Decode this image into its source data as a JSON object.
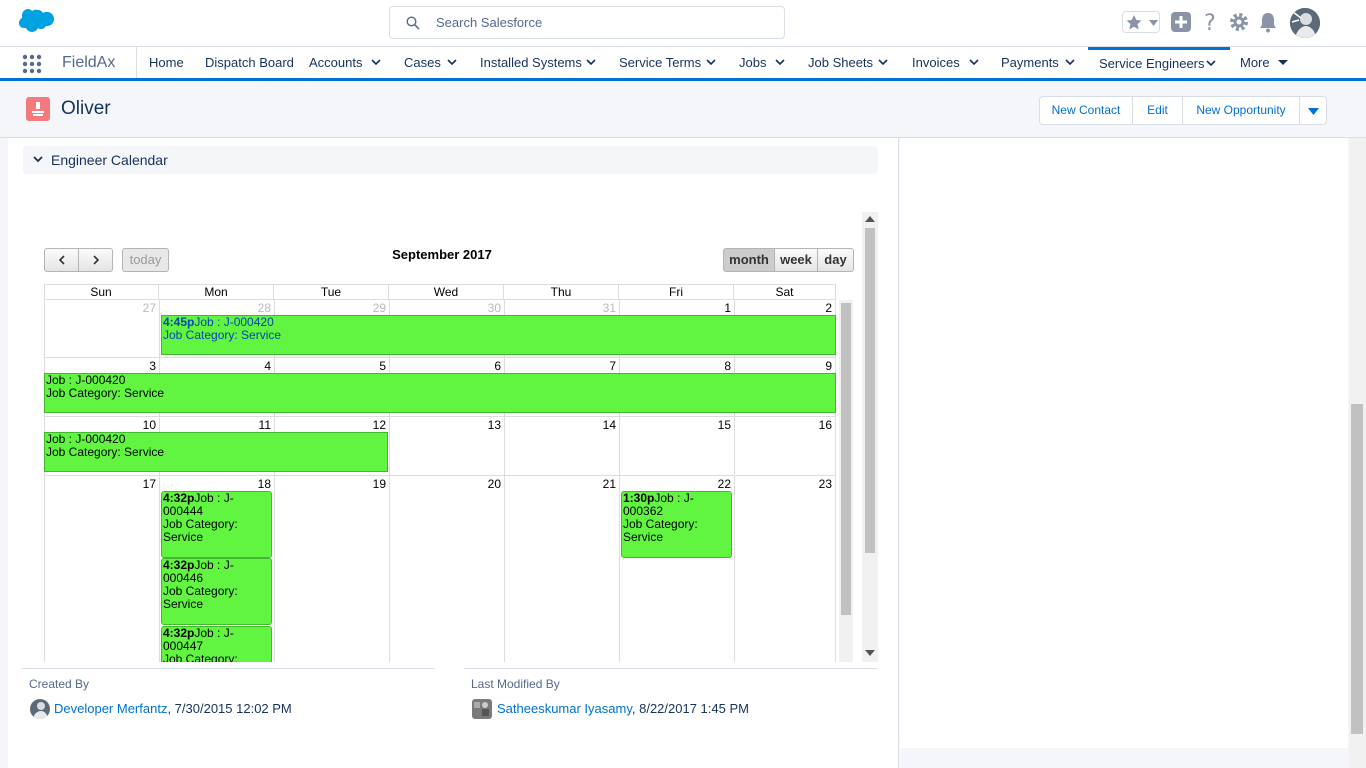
{
  "header": {
    "search_placeholder": "Search Salesforce"
  },
  "nav": {
    "app_name": "FieldAx",
    "items": [
      {
        "label": "Home"
      },
      {
        "label": "Dispatch Board"
      },
      {
        "label": "Accounts"
      },
      {
        "label": "Cases"
      },
      {
        "label": "Installed Systems"
      },
      {
        "label": "Service Terms"
      },
      {
        "label": "Jobs"
      },
      {
        "label": "Job Sheets"
      },
      {
        "label": "Invoices"
      },
      {
        "label": "Payments"
      },
      {
        "label": "Service Engineers"
      },
      {
        "label": "More"
      }
    ]
  },
  "record": {
    "title": "Oliver",
    "actions": [
      "New Contact",
      "Edit",
      "New Opportunity"
    ]
  },
  "section": {
    "title": "Engineer Calendar"
  },
  "calendar": {
    "title": "September 2017",
    "today_label": "today",
    "views": [
      "month",
      "week",
      "day"
    ],
    "day_headers": [
      "Sun",
      "Mon",
      "Tue",
      "Wed",
      "Thu",
      "Fri",
      "Sat"
    ],
    "weeks": [
      [
        "27",
        "28",
        "29",
        "30",
        "31",
        "1",
        "2"
      ],
      [
        "3",
        "4",
        "5",
        "6",
        "7",
        "8",
        "9"
      ],
      [
        "10",
        "11",
        "12",
        "13",
        "14",
        "15",
        "16"
      ],
      [
        "17",
        "18",
        "19",
        "20",
        "21",
        "22",
        "23"
      ]
    ],
    "events": {
      "e1_time": "4:45p",
      "e1_title": "Job : J-000420",
      "e1_cat": "Job Category: Service",
      "e2_title": "Job : J-000420",
      "e2_cat": "Job Category: Service",
      "e3_title": "Job : J-000420",
      "e3_cat": "Job Category: Service",
      "e4_time": "4:32p",
      "e4_title": "Job : J-000444",
      "e4_cat": "Job Category: Service",
      "e5_time": "4:32p",
      "e5_title": "Job : J-000446",
      "e5_cat": "Job Category: Service",
      "e6_time": "4:32p",
      "e6_title": "Job : J-000447",
      "e6_cat": "Job Category: Service",
      "e7_time": "1:30p",
      "e7_title": "Job : J-000362",
      "e7_cat": "Job Category: Service"
    }
  },
  "meta": {
    "created_label": "Created By",
    "created_user": "Developer Merfantz",
    "created_date": ", 7/30/2015 12:02 PM",
    "modified_label": "Last Modified By",
    "modified_user": "Satheeskumar Iyasamy",
    "modified_date": ", 8/22/2017 1:45 PM"
  },
  "colors": {
    "brand_blue": "#0070d2",
    "event_green": "#61f542"
  }
}
